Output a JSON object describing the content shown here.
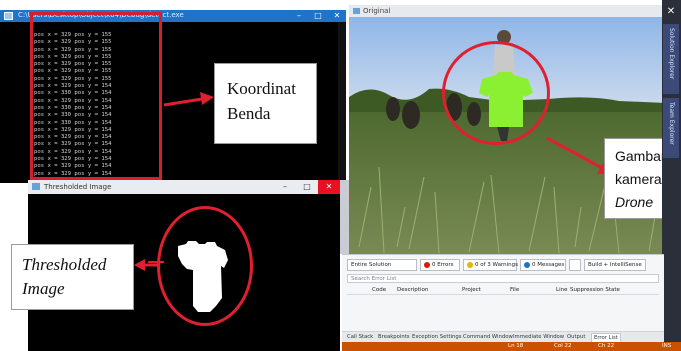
{
  "console": {
    "title": "C:\\Users\\Desktop\\Object\\x64\\Debug\\detect.exe",
    "minimize": "–",
    "maximize": "□",
    "close": "✕",
    "lines": [
      "pos x = 329 pos y = 155",
      "pos x = 329 pos y = 155",
      "pos x = 329 pos y = 155",
      "pos x = 329 pos y = 155",
      "pos x = 329 pos y = 155",
      "pos x = 329 pos y = 155",
      "pos x = 329 pos y = 155",
      "pos x = 329 pos y = 154",
      "pos x = 330 pos y = 154",
      "pos x = 329 pos y = 154",
      "pos x = 330 pos y = 154",
      "pos x = 330 pos y = 154",
      "pos x = 330 pos y = 154",
      "pos x = 329 pos y = 154",
      "pos x = 329 pos y = 154",
      "pos x = 329 pos y = 154",
      "pos x = 329 pos y = 154",
      "pos x = 329 pos y = 154",
      "pos x = 329 pos y = 154",
      "pos x = 329 pos y = 154"
    ]
  },
  "labels": {
    "koordinat_line1": "Koordinat",
    "koordinat_line2": "Benda",
    "thresholded_line1": "Thresholded",
    "thresholded_line2": "Image",
    "gambar_line1": "Gambar",
    "gambar_line2": "kamera",
    "gambar_line3": "Drone"
  },
  "threshold_window": {
    "title": "Thresholded Image",
    "minimize": "–",
    "maximize": "□",
    "close": "✕"
  },
  "drone_window": {
    "title": "Original"
  },
  "vs": {
    "close": "✕",
    "tabs": [
      "Solution Explorer",
      "Team Explorer"
    ]
  },
  "error_list": {
    "scope": "Entire Solution",
    "errors": "0 Errors",
    "warnings": "0 of 3 Warnings",
    "messages": "0 Messages",
    "build": "Build + IntelliSense",
    "search_placeholder": "Search Error List",
    "columns": [
      "Code",
      "Description",
      "Project",
      "File",
      "Line",
      "Suppression State"
    ],
    "tabs": [
      "Call Stack",
      "Breakpoints",
      "Exception Settings",
      "Command Window",
      "Immediate Window",
      "Output",
      "Error List"
    ]
  },
  "status": {
    "ln": "Ln 18",
    "col": "Col 22",
    "ch": "Ch 22",
    "mode": "INS"
  },
  "colors": {
    "highlight": "#e02030",
    "shirt": "#8cf032",
    "status_bar": "#ca5100"
  }
}
